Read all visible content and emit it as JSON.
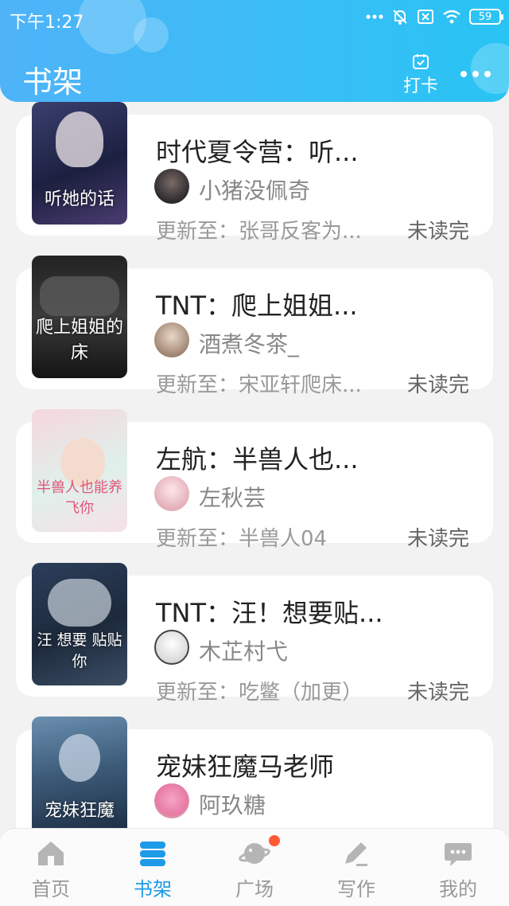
{
  "status_bar": {
    "time": "下午1:27",
    "battery": "59"
  },
  "header": {
    "title": "书架",
    "checkin_label": "打卡"
  },
  "books": [
    {
      "title": "时代夏令营：听...",
      "author": "小猪没佩奇",
      "update": "更新至：张哥反客为...",
      "status": "未读完",
      "cover_text": "听她的话"
    },
    {
      "title": "TNT：爬上姐姐...",
      "author": "酒煮冬茶_",
      "update": "更新至：宋亚轩爬床...",
      "status": "未读完",
      "cover_text": "爬上姐姐的床"
    },
    {
      "title": "左航：半兽人也...",
      "author": "左秋芸",
      "update": "更新至：半兽人04",
      "status": "未读完",
      "cover_text": "半兽人也能养飞你"
    },
    {
      "title": "TNT：汪！想要贴...",
      "author": "木芷村弋",
      "update": "更新至：吃鳖（加更）",
      "status": "未读完",
      "cover_text": "汪 想要 贴贴你"
    },
    {
      "title": "宠妹狂魔马老师",
      "author": "阿玖糖",
      "update": "",
      "status": "",
      "cover_text": "宠妹狂魔"
    }
  ],
  "tabs": [
    {
      "label": "首页",
      "icon": "home-icon"
    },
    {
      "label": "书架",
      "icon": "bookshelf-icon"
    },
    {
      "label": "广场",
      "icon": "planet-icon"
    },
    {
      "label": "写作",
      "icon": "pen-icon"
    },
    {
      "label": "我的",
      "icon": "chat-bubble-icon"
    }
  ],
  "colors": {
    "accent": "#1e9be8",
    "header_start": "#4fb3f8",
    "header_end": "#29c4f4",
    "badge": "#ff5a36"
  }
}
